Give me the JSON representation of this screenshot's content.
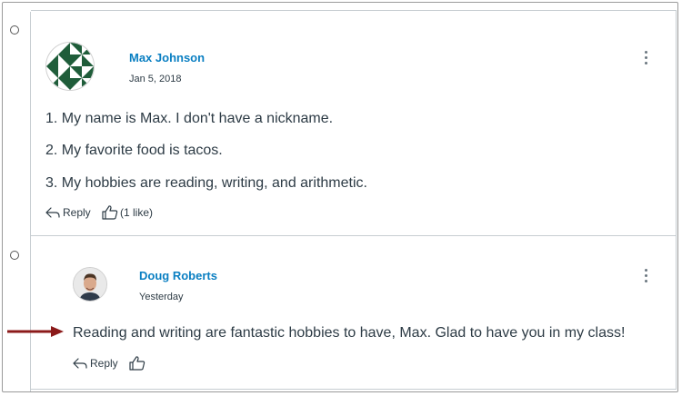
{
  "entries": [
    {
      "author": "Max Johnson",
      "date": "Jan 5, 2018",
      "lines": [
        "1. My name is Max. I don't have a nickname.",
        "2. My favorite food is tacos.",
        "3. My hobbies are reading, writing, and arithmetic."
      ],
      "reply_label": "Reply",
      "like_label": "(1 like)",
      "avatar_icon": "geometric-pattern-avatar"
    },
    {
      "author": "Doug Roberts",
      "date": "Yesterday",
      "lines": [
        "Reading and writing are fantastic hobbies to have, Max. Glad to have you in my class!"
      ],
      "reply_label": "Reply",
      "avatar_icon": "person-photo-avatar"
    }
  ],
  "colors": {
    "author_link": "#0a7fc2",
    "text": "#2d3b45",
    "annotation_arrow": "#8b1a1a",
    "border": "#c7cdd1"
  }
}
